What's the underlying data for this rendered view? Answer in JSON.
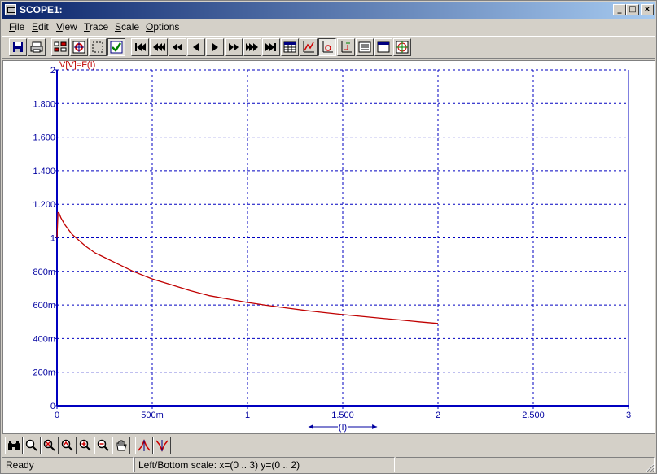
{
  "window": {
    "title": "SCOPE1:",
    "minimize": "_",
    "maximize": "□",
    "close": "×"
  },
  "menu": [
    {
      "label": "File",
      "key": "F",
      "rest": "ile"
    },
    {
      "label": "Edit",
      "key": "E",
      "rest": "dit"
    },
    {
      "label": "View",
      "key": "V",
      "rest": "iew"
    },
    {
      "label": "Trace",
      "key": "T",
      "rest": "race"
    },
    {
      "label": "Scale",
      "key": "S",
      "rest": "cale"
    },
    {
      "label": "Options",
      "key": "O",
      "rest": "ptions"
    }
  ],
  "toolbar": {
    "groups": [
      [
        "save-icon",
        "print-icon"
      ],
      [
        "properties-icon",
        "scope-target-icon",
        "select-rect-icon",
        "check-icon"
      ],
      [
        "first-icon",
        "rewind-fast-icon",
        "rewind-icon",
        "step-back-icon",
        "play-icon",
        "fast-forward-icon",
        "forward-fast-icon",
        "last-icon",
        "grid-table-icon",
        "graph-icon",
        "scale-icon",
        "axis-icon",
        "list-icon",
        "window-icon",
        "crosshair-icon"
      ]
    ]
  },
  "chart_data": {
    "type": "line",
    "title": "V[V]=F(I)",
    "xlabel": "(I)",
    "ylabel": "",
    "xlim": [
      0,
      3
    ],
    "ylim": [
      0,
      2
    ],
    "x_ticks": [
      0,
      0.5,
      1,
      1.5,
      2,
      2.5,
      3
    ],
    "x_tick_labels": [
      "0",
      "500m",
      "1",
      "1.500",
      "2",
      "2.500",
      "3"
    ],
    "y_ticks": [
      0,
      0.2,
      0.4,
      0.6,
      0.8,
      1,
      1.2,
      1.4,
      1.6,
      1.8,
      2
    ],
    "y_tick_labels": [
      "0",
      "200m",
      "400m",
      "600m",
      "800m",
      "1",
      "1.200",
      "1.400",
      "1.600",
      "1.800",
      "2"
    ],
    "grid": true,
    "series": [
      {
        "color": "#c00000",
        "x": [
          0,
          0.005,
          0.01,
          0.02,
          0.04,
          0.06,
          0.08,
          0.1,
          0.15,
          0.2,
          0.3,
          0.4,
          0.5,
          0.6,
          0.7,
          0.8,
          0.9,
          1.0,
          1.1,
          1.2,
          1.3,
          1.4,
          1.5,
          1.6,
          1.7,
          1.8,
          1.9,
          2.0
        ],
        "y": [
          1.0,
          1.15,
          1.15,
          1.12,
          1.08,
          1.05,
          1.02,
          1.0,
          0.95,
          0.91,
          0.855,
          0.8,
          0.755,
          0.72,
          0.685,
          0.655,
          0.635,
          0.615,
          0.598,
          0.583,
          0.568,
          0.555,
          0.543,
          0.532,
          0.521,
          0.511,
          0.5,
          0.49
        ]
      }
    ]
  },
  "bottom_toolbar": {
    "icons": [
      "binoculars-icon",
      "zoom-icon",
      "zoom-cancel-icon",
      "zoom-reset-icon",
      "zoom-in-icon",
      "zoom-out-icon",
      "pan-hand-icon",
      "peak-max-icon",
      "peak-min-icon"
    ]
  },
  "status": {
    "left": "Ready",
    "middle": "Left/Bottom scale:  x=(0 ..  3) y=(0 ..  2)",
    "right": ""
  }
}
